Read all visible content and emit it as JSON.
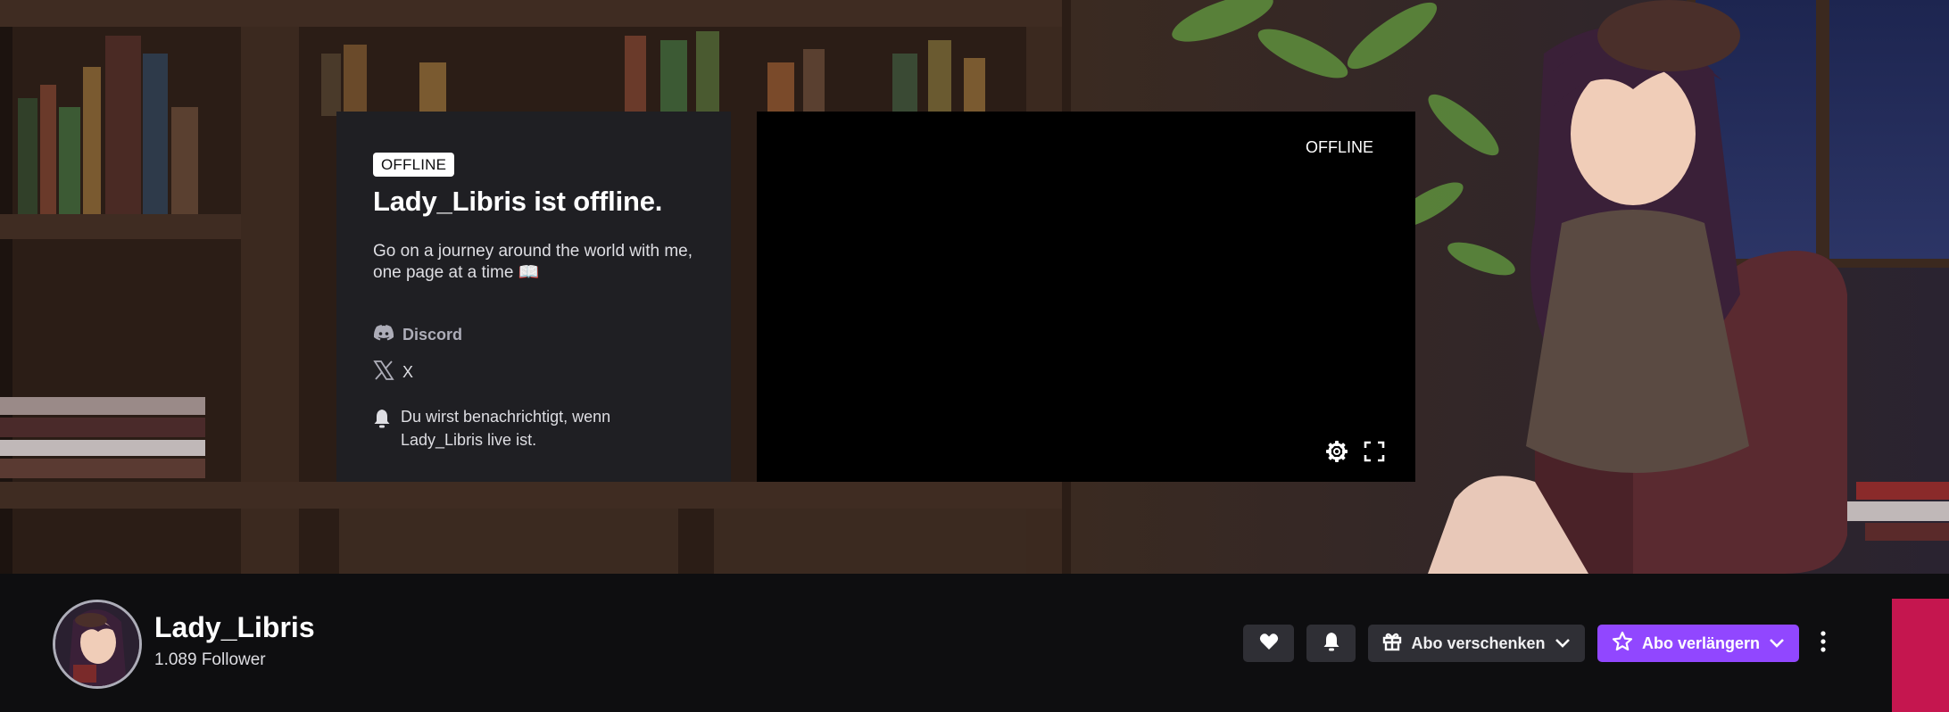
{
  "banner": {
    "background": "library illustration",
    "colors": {
      "shelf": "#3a2820",
      "wall": "#4a3a2c",
      "plant": "#5c8a3c",
      "chair": "#5a2a30"
    }
  },
  "info_card": {
    "badge": "OFFLINE",
    "title": "Lady_Libris ist offline.",
    "description": "Go on a journey around the world with me, one page at a time 📖",
    "links": [
      {
        "label": "Discord",
        "icon": "discord-icon"
      },
      {
        "label": "X",
        "icon": "x-icon"
      }
    ],
    "notification_text": "Du wirst benachrichtigt, wenn Lady_Libris live ist."
  },
  "player": {
    "status": "OFFLINE",
    "controls": [
      "gear-icon",
      "fullscreen-icon"
    ]
  },
  "channel": {
    "name": "Lady_Libris",
    "followers": "1.089 Follower",
    "buttons": {
      "follow_icon": "heart-icon",
      "notify_icon": "bell-icon",
      "gift_label": "Abo verschenken",
      "sub_label": "Abo verlängern"
    }
  },
  "colors": {
    "accent": "#9147ff",
    "button_bg": "#2f2f35",
    "card_bg": "#1f1f23",
    "page_bg": "#0e0e10",
    "edge_strip": "#c5164f"
  }
}
